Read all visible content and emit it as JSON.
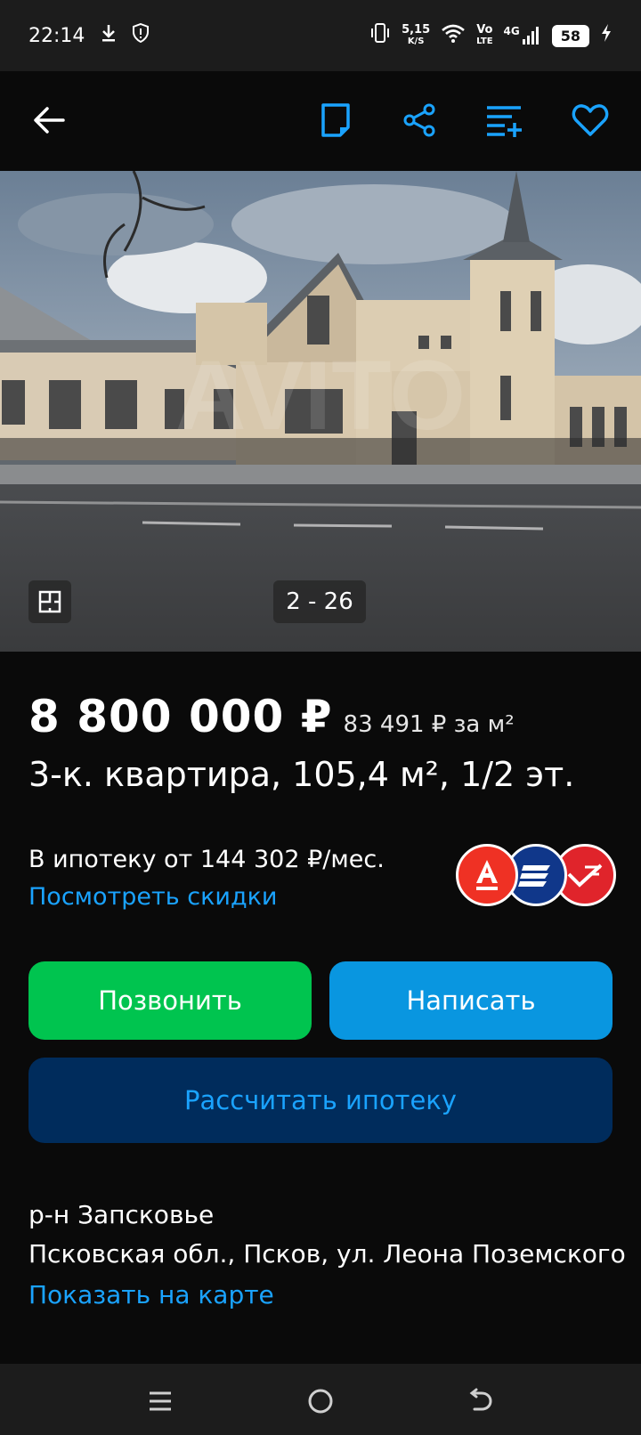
{
  "status_bar": {
    "time": "22:14",
    "net_speed_value": "5,15",
    "net_speed_unit": "K/S",
    "volte_top": "Vo",
    "volte_bottom": "LTE",
    "network": "4G",
    "battery": "58",
    "icons": [
      "download-icon",
      "shield-icon",
      "vibrate-icon",
      "wifi-icon",
      "signal-icon",
      "battery-icon",
      "charging-icon"
    ]
  },
  "toolbar": {
    "icons": [
      "back-arrow-icon",
      "note-icon",
      "share-icon",
      "compare-icon",
      "favorite-heart-icon"
    ],
    "accent": "#1aa3ff"
  },
  "gallery": {
    "counter": "2 - 26",
    "watermark": "AVITO",
    "plan_icon": "floor-plan-icon"
  },
  "listing": {
    "price": "8 800 000 ₽",
    "price_per_m2": "83 491 ₽ за м²",
    "title": "3-к. квартира, 105,4 м², 1/2 эт.",
    "mortgage_text": "В ипотеку от 144 302 ₽/мес.",
    "discount_link": "Посмотреть скидки",
    "banks": [
      "alfa-bank-logo",
      "gazprombank-logo",
      "pochta-bank-logo"
    ]
  },
  "actions": {
    "call": "Позвонить",
    "write": "Написать",
    "calc_mortgage": "Рассчитать ипотеку",
    "call_color": "#00c44f",
    "write_color": "#0996e0",
    "calc_color": "#002c5c"
  },
  "location": {
    "district": "р-н Запсковье",
    "address": "Псковская обл., Псков, ул. Леона Поземского",
    "map_link": "Показать на карте"
  },
  "nav_bar": {
    "icons": [
      "menu-icon",
      "home-circle-icon",
      "back-icon"
    ]
  }
}
